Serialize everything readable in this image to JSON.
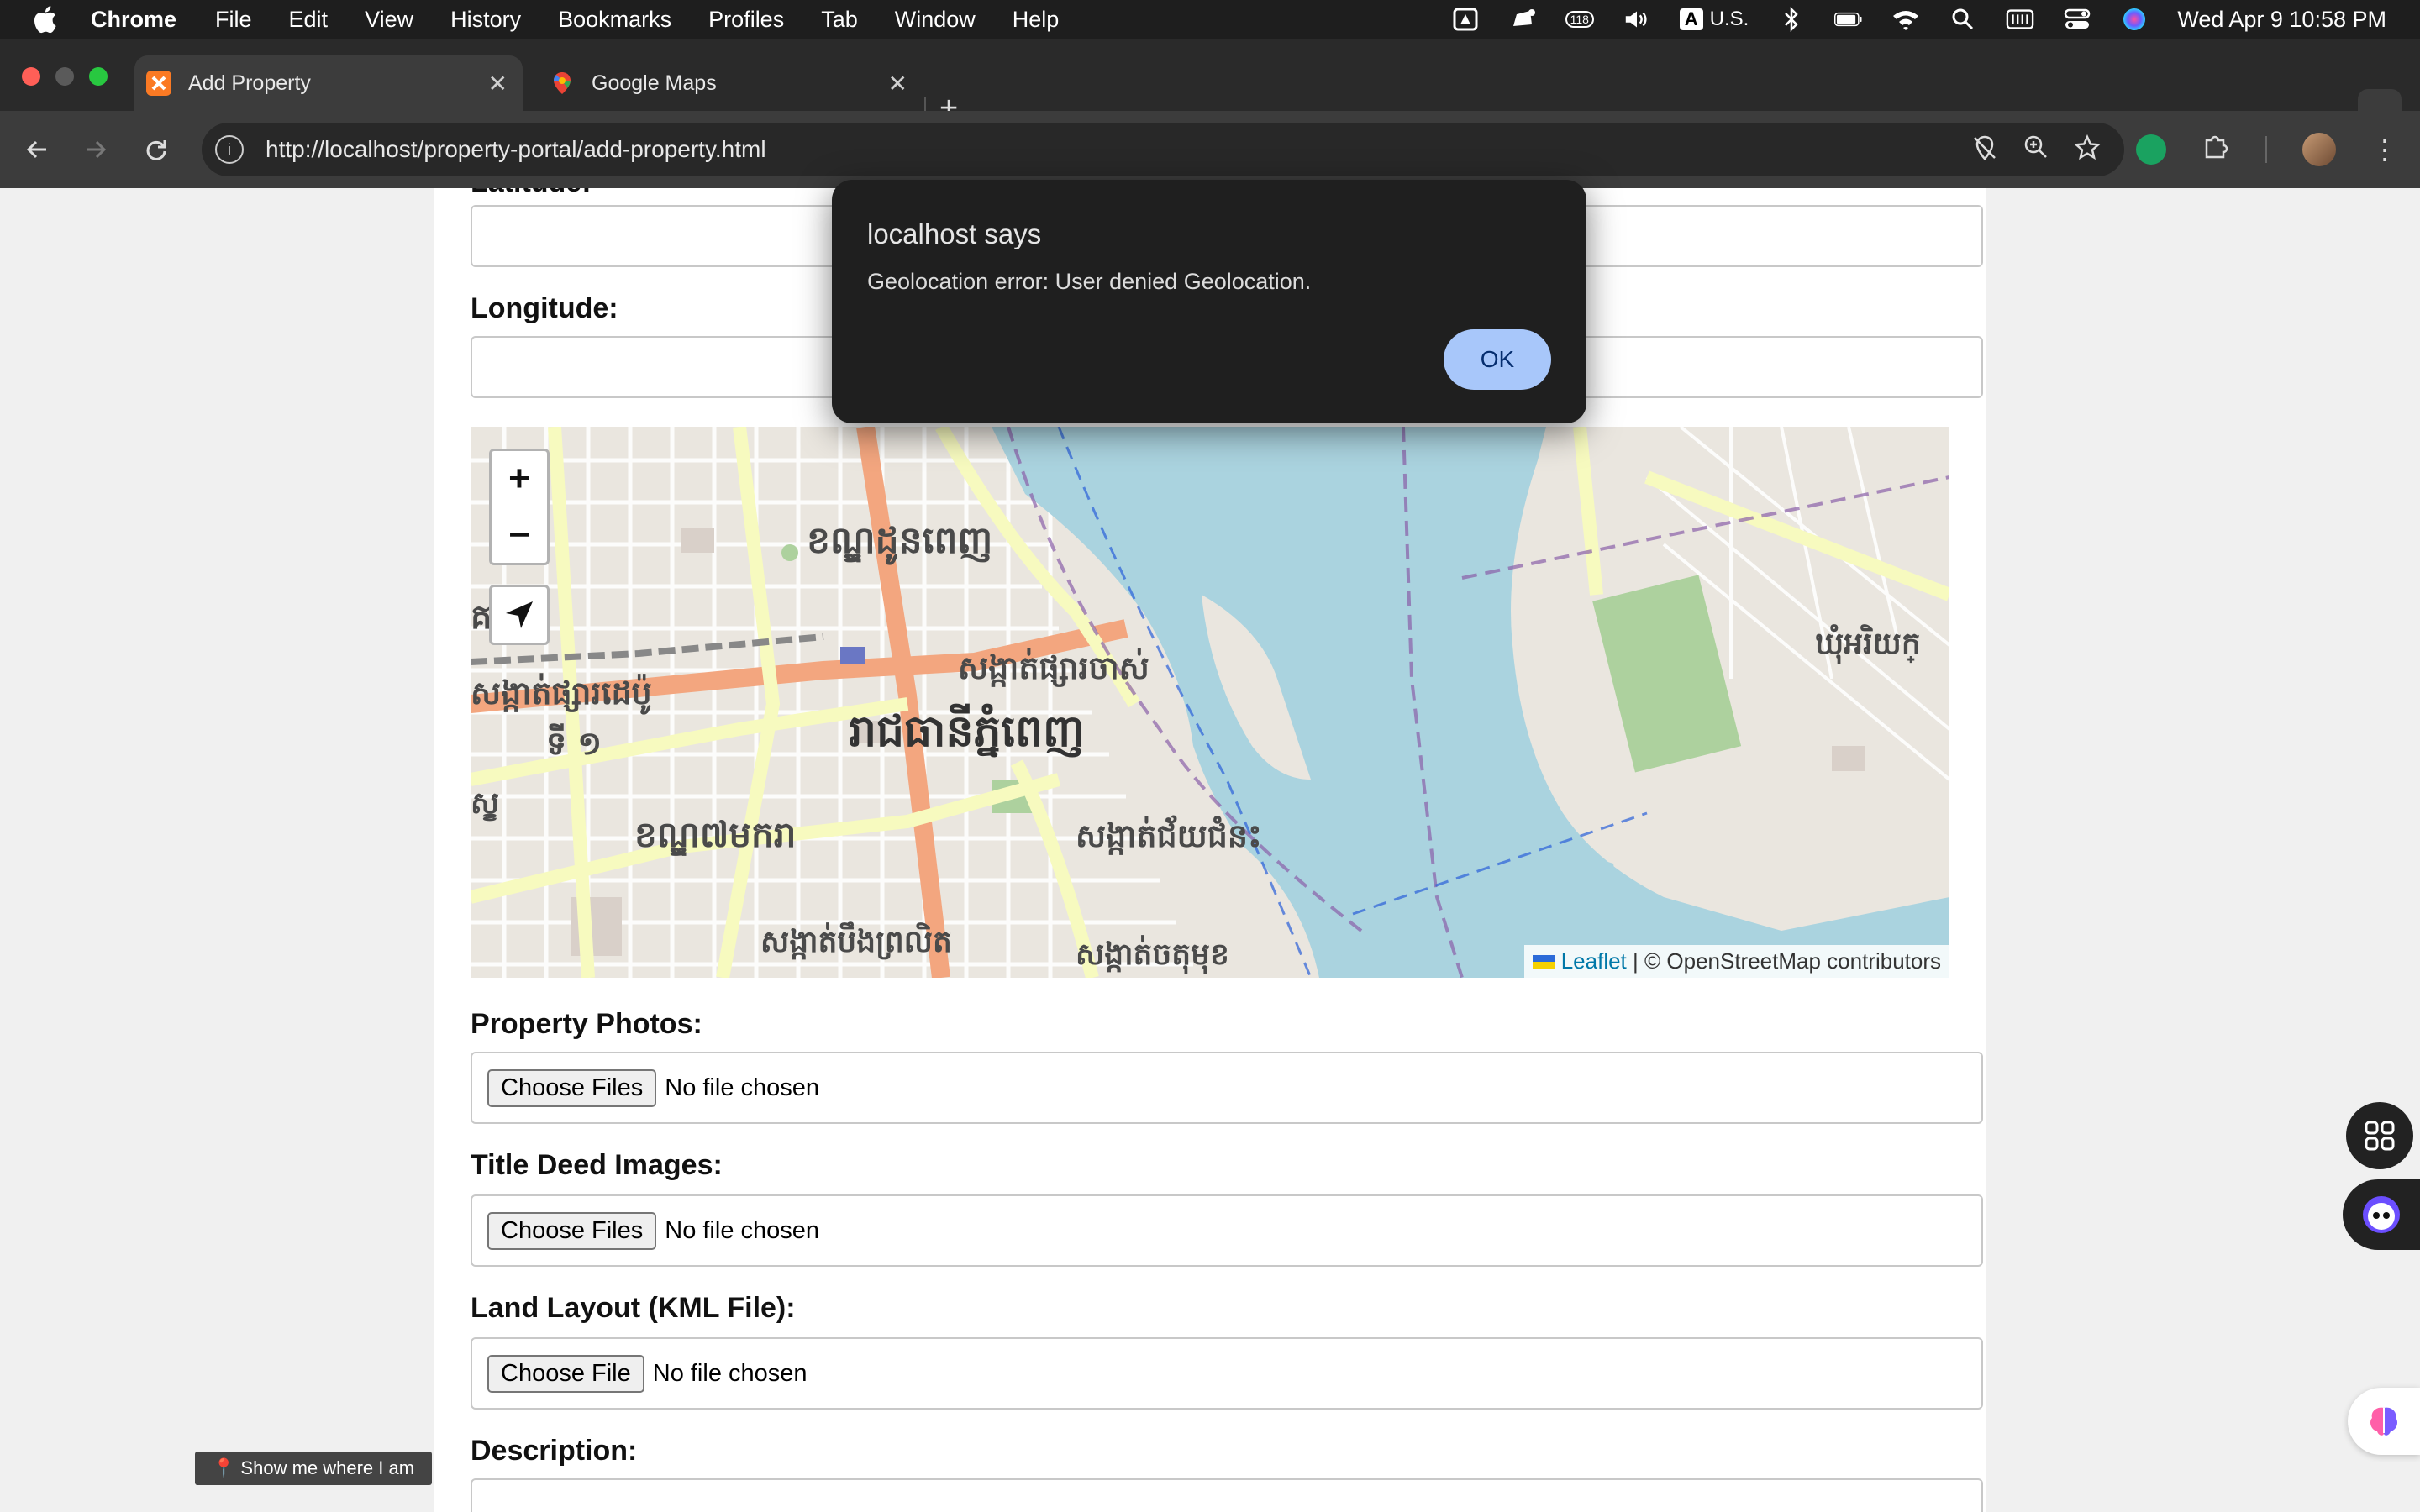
{
  "menubar": {
    "app_name": "Chrome",
    "items": [
      "File",
      "Edit",
      "View",
      "History",
      "Bookmarks",
      "Profiles",
      "Tab",
      "Window",
      "Help"
    ],
    "badge_count": "118",
    "input_source": "U.S.",
    "input_letter": "A",
    "datetime": "Wed Apr 9  10:58 PM"
  },
  "tabs": {
    "active_title": "Add Property",
    "inactive_title": "Google Maps"
  },
  "toolbar": {
    "url": "http://localhost/property-portal/add-property.html"
  },
  "form": {
    "latitude_label": "Latitude:",
    "longitude_label": "Longitude:",
    "photos_label": "Property Photos:",
    "title_deed_label": "Title Deed Images:",
    "land_layout_label": "Land Layout (KML File):",
    "description_label": "Description:",
    "choose_files": "Choose Files",
    "choose_file": "Choose File",
    "no_file": "No file chosen"
  },
  "map": {
    "zoom_in": "+",
    "zoom_out": "−",
    "attribution_link": "Leaflet",
    "attribution_sep": " | ",
    "attribution_text": "© OpenStreetMap contributors",
    "labels": {
      "district_north": "ខណ្ឌដូនពេញ",
      "sangkat_west": "ផ្សារដេប៉ូ",
      "sangkat_kat": "គាត",
      "sangkat_depo": "សង្កាត់ផ្សារដេប៉ូ",
      "number_1": "ទី ១",
      "sangkat_old_market": "សង្កាត់ផ្សារចាស់",
      "capital": "រាជធានីភ្នំពេញ",
      "sangkat_kh": "ស្ខ",
      "district_mean_chey": "ខណ្ឌ៧មករា",
      "sangkat_chey_chumneah": "សង្កាត់ជ័យជំនះ",
      "sangkat_boeng": "សង្កាត់បឹងព្រលិត",
      "sangkat_chaktomuk": "សង្កាត់ចតុមុខ",
      "east_label": "ឃុំអរិយក្"
    }
  },
  "dialog": {
    "title": "localhost says",
    "message": "Geolocation error: User denied Geolocation.",
    "ok": "OK"
  },
  "overlay": {
    "show_me": "📍 Show me where I am"
  },
  "colors": {
    "river": "#aad3df",
    "main_road": "#f3a67f",
    "secondary_road": "#f7fabf",
    "park": "#add19e",
    "dialog_bg": "#1f1f1f",
    "ok_button": "#a8c7fa"
  }
}
